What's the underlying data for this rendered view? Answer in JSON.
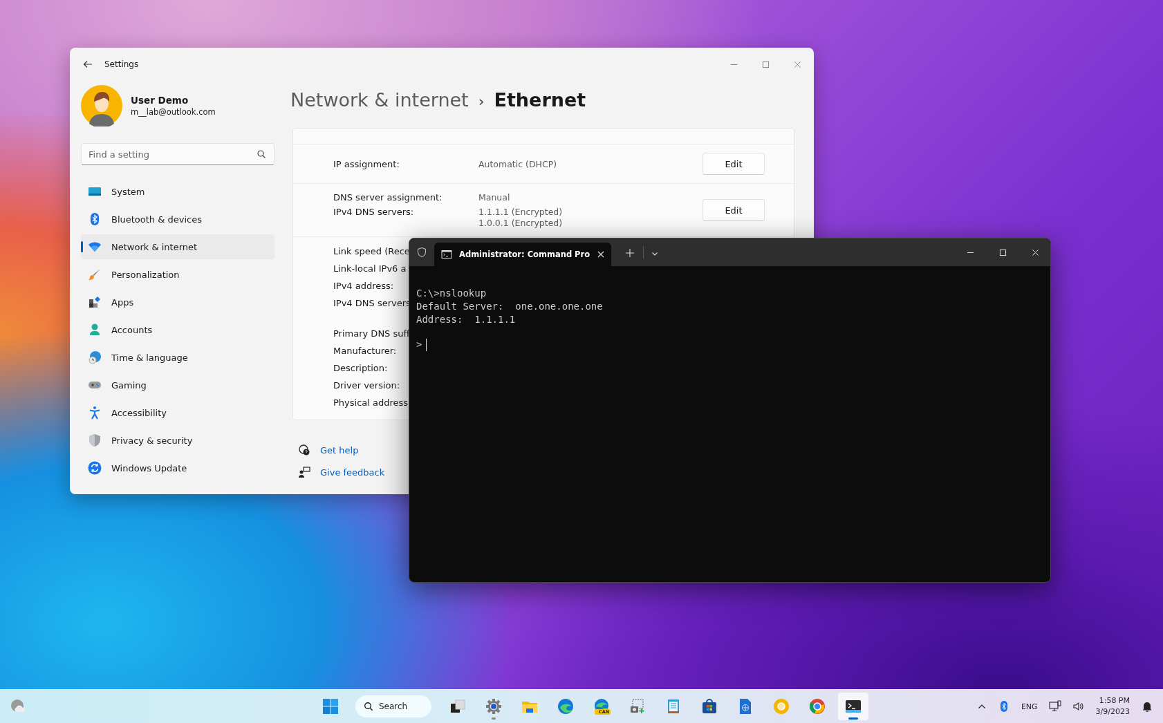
{
  "settings_window": {
    "title": "Settings",
    "user": {
      "name": "User Demo",
      "email": "m__lab@outlook.com"
    },
    "search": {
      "placeholder": "Find a setting"
    },
    "nav_items": [
      {
        "label": "System",
        "selected": false
      },
      {
        "label": "Bluetooth & devices",
        "selected": false
      },
      {
        "label": "Network & internet",
        "selected": true
      },
      {
        "label": "Personalization",
        "selected": false
      },
      {
        "label": "Apps",
        "selected": false
      },
      {
        "label": "Accounts",
        "selected": false
      },
      {
        "label": "Time & language",
        "selected": false
      },
      {
        "label": "Gaming",
        "selected": false
      },
      {
        "label": "Accessibility",
        "selected": false
      },
      {
        "label": "Privacy & security",
        "selected": false
      },
      {
        "label": "Windows Update",
        "selected": false
      }
    ],
    "breadcrumb": {
      "parent": "Network & internet",
      "separator": "›",
      "current": "Ethernet"
    },
    "property_rows": [
      {
        "lines": [
          {
            "label": "IP assignment:",
            "values": [
              "Automatic (DHCP)"
            ]
          }
        ],
        "button": "Edit"
      },
      {
        "lines": [
          {
            "label": "DNS server assignment:",
            "values": [
              "Manual"
            ]
          },
          {
            "label": "IPv4 DNS servers:",
            "values": [
              "1.1.1.1 (Encrypted)",
              "1.0.0.1 (Encrypted)"
            ]
          }
        ],
        "button": "Edit"
      }
    ],
    "detail_groups": [
      {
        "labels": [
          "Link speed (Rece",
          "Link-local IPv6 a",
          "IPv4 address:",
          "IPv4 DNS servers"
        ]
      },
      {
        "labels": [
          "Primary DNS suff",
          "Manufacturer:",
          "Description:",
          "Driver version:",
          "Physical address"
        ]
      }
    ],
    "links": [
      {
        "label": "Get help"
      },
      {
        "label": "Give feedback"
      }
    ]
  },
  "terminal": {
    "tab_title": "Administrator: Command Pro",
    "output": [
      "C:\\>nslookup",
      "Default Server:  one.one.one.one",
      "Address:  1.1.1.1"
    ],
    "prompt": ">"
  },
  "taskbar": {
    "search": {
      "label": "Search"
    },
    "apps": [
      {
        "selected": false,
        "running": false
      },
      {
        "selected": false,
        "running": true
      },
      {
        "selected": false,
        "running": false
      },
      {
        "selected": false,
        "running": false
      },
      {
        "selected": false,
        "running": false,
        "badge": "CAN"
      },
      {
        "selected": false,
        "running": false
      },
      {
        "selected": false,
        "running": false
      },
      {
        "selected": false,
        "running": false
      },
      {
        "selected": false,
        "running": false
      },
      {
        "selected": false,
        "running": false
      },
      {
        "selected": false,
        "running": false
      },
      {
        "selected": true,
        "running": true
      }
    ],
    "language": "ENG",
    "time": "1:58 PM",
    "date": "3/9/2023"
  }
}
